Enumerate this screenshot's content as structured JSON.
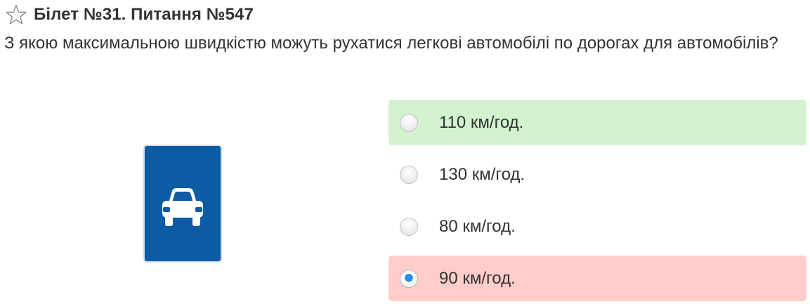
{
  "header": {
    "title": "Білет №31. Питання №547"
  },
  "question": {
    "text": "З якою максимальною швидкістю можуть рухатися легкові автомобілі по дорогах для автомобілів?"
  },
  "sign": {
    "icon": "car-icon",
    "background_color": "#0b5ba5"
  },
  "answers": [
    {
      "label": "110 км/год.",
      "state": "correct",
      "selected": false
    },
    {
      "label": "130 км/год.",
      "state": "neutral",
      "selected": false
    },
    {
      "label": "80 км/год.",
      "state": "neutral",
      "selected": false
    },
    {
      "label": "90 км/год.",
      "state": "wrong",
      "selected": true
    }
  ],
  "colors": {
    "correct_bg": "#d2f2d0",
    "wrong_bg": "#ffcdc9",
    "selected_radio": "#1f86e0"
  }
}
